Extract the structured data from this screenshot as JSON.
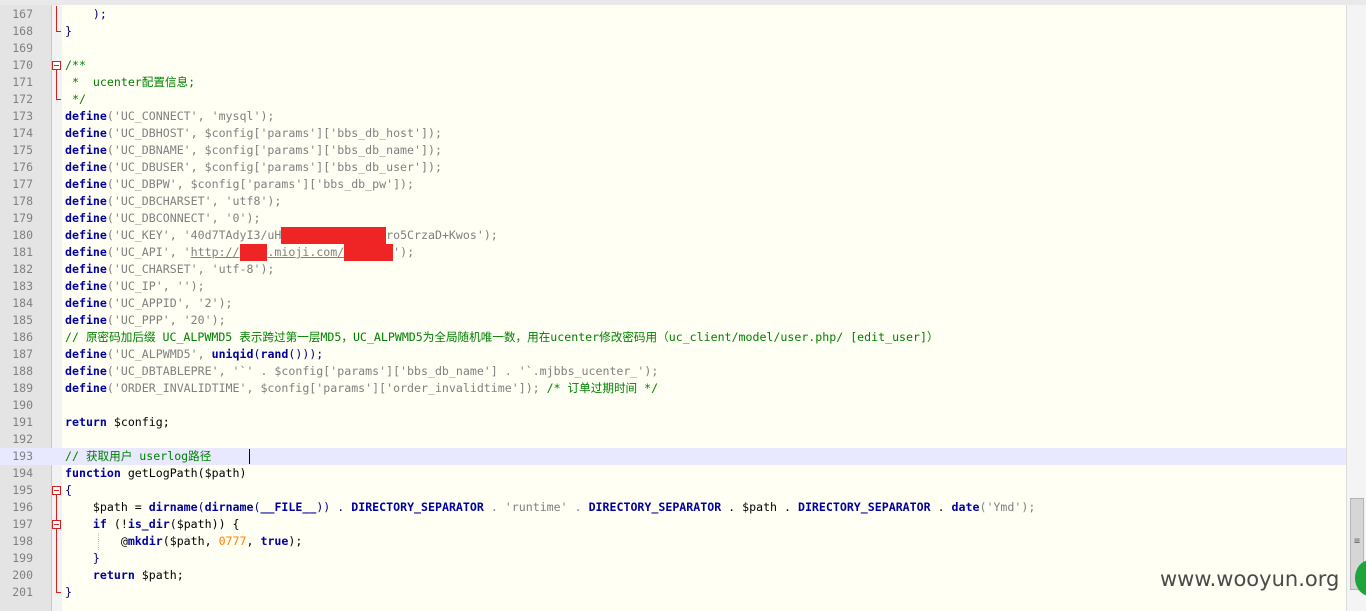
{
  "editor": {
    "line_numbers": [
      "167",
      "168",
      "169",
      "170",
      "171",
      "172",
      "173",
      "174",
      "175",
      "176",
      "177",
      "178",
      "179",
      "180",
      "181",
      "182",
      "183",
      "184",
      "185",
      "186",
      "187",
      "188",
      "189",
      "190",
      "191",
      "192",
      "193",
      "194",
      "195",
      "196",
      "197",
      "198",
      "199",
      "200",
      "201"
    ],
    "lines": {
      "l167": "    );",
      "l168": "}",
      "l169": "",
      "l170": "/**",
      "l171": " *  ucenter配置信息;",
      "l172": " */",
      "l173_a": "define",
      "l173_b": "('UC_CONNECT', 'mysql');",
      "l174_a": "define",
      "l174_b": "('UC_DBHOST', $config['params']['bbs_db_host']);",
      "l175_a": "define",
      "l175_b": "('UC_DBNAME', $config['params']['bbs_db_name']);",
      "l176_a": "define",
      "l176_b": "('UC_DBUSER', $config['params']['bbs_db_user']);",
      "l177_a": "define",
      "l177_b": "('UC_DBPW', $config['params']['bbs_db_pw']);",
      "l178_a": "define",
      "l178_b": "('UC_DBCHARSET', 'utf8');",
      "l179_a": "define",
      "l179_b": "('UC_DBCONNECT', '0');",
      "l180_a": "define",
      "l180_b": "('UC_KEY', '40d7TAdyI3/uH",
      "l180_redacted": "xxxxxxxxxxxxxxx",
      "l180_c": "ro5CrzaD+Kwos');",
      "l181_a": "define",
      "l181_b": "('UC_API', '",
      "l181_url_a": "http://",
      "l181_redacted_a": "xxxx",
      "l181_url_b": ".mioji.com/",
      "l181_redacted_b": "xxxxxxx",
      "l181_c": "');",
      "l182_a": "define",
      "l182_b": "('UC_CHARSET', 'utf-8');",
      "l183_a": "define",
      "l183_b": "('UC_IP', '');",
      "l184_a": "define",
      "l184_b": "('UC_APPID', '2');",
      "l185_a": "define",
      "l185_b": "('UC_PPP', '20');",
      "l186": "// 原密码加后缀 UC_ALPWMD5 表示跨过第一层MD5，UC_ALPWMD5为全局随机唯一数，用在ucenter修改密码用（uc_client/model/user.php/ [edit_user]）",
      "l187_a": "define",
      "l187_b": "('UC_ALPWMD5', ",
      "l187_c": "uniqid",
      "l187_d": "(",
      "l187_e": "rand",
      "l187_f": "()));",
      "l188_a": "define",
      "l188_b": "('UC_DBTABLEPRE', '`' . $config['params']['bbs_db_name'] . '`.mjbbs_ucenter_');",
      "l189_a": "define",
      "l189_b": "('ORDER_INVALIDTIME', $config['params']['order_invalidtime']); ",
      "l189_c": "/* 订单过期时间 */",
      "l190": "",
      "l191_a": "return",
      "l191_b": " $config;",
      "l192": "",
      "l193": "// 获取用户 userlog路径",
      "l194_a": "function",
      "l194_b": " getLogPath($path)",
      "l195": "{",
      "l196_a": "    $path = ",
      "l196_b": "dirname",
      "l196_c": "(",
      "l196_d": "dirname",
      "l196_e": "(",
      "l196_f": "__FILE__",
      "l196_g": ")) . ",
      "l196_h": "DIRECTORY_SEPARATOR",
      "l196_i": " . 'runtime' . ",
      "l196_j": "DIRECTORY_SEPARATOR",
      "l196_k": " . $path . ",
      "l196_l": "DIRECTORY_SEPARATOR",
      "l196_m": " . ",
      "l196_n": "date",
      "l196_o": "('Ymd');",
      "l197_a": "    ",
      "l197_b": "if",
      "l197_c": " (!",
      "l197_d": "is_dir",
      "l197_e": "($path)) {",
      "l198_a": "        @",
      "l198_b": "mkdir",
      "l198_c": "($path, ",
      "l198_d": "0777",
      "l198_e": ", ",
      "l198_f": "true",
      "l198_g": ");",
      "l199": "    }",
      "l200_a": "    ",
      "l200_b": "return",
      "l200_c": " $path;",
      "l201": "}"
    }
  },
  "watermark": {
    "text": "www.wooyun.org"
  },
  "colors": {
    "keyword": "#0000a0",
    "string": "#808080",
    "comment": "#008000",
    "number": "#ff8000",
    "redaction": "#ef2424",
    "background": "#fffff4"
  }
}
